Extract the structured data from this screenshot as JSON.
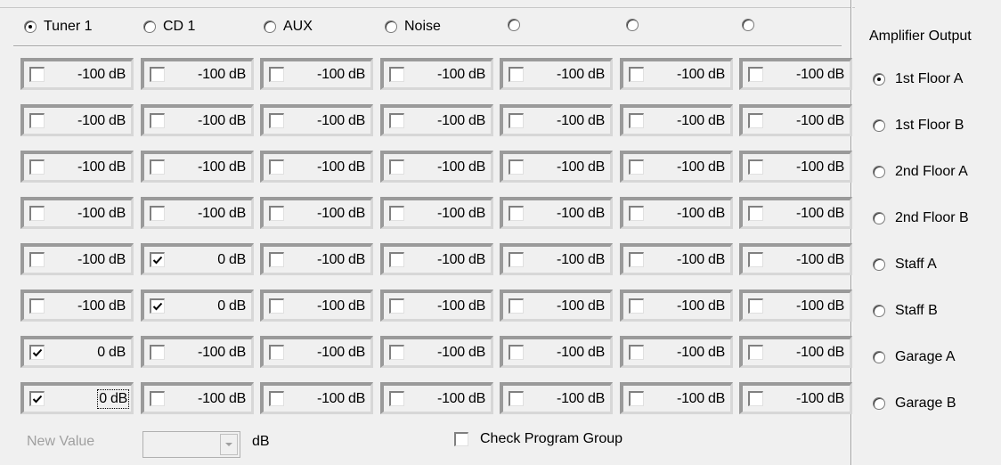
{
  "sources": [
    {
      "label": "Tuner 1",
      "checked": true
    },
    {
      "label": "CD 1",
      "checked": false
    },
    {
      "label": "AUX",
      "checked": false
    },
    {
      "label": "Noise",
      "checked": false
    },
    {
      "label": "",
      "checked": false
    },
    {
      "label": "",
      "checked": false
    },
    {
      "label": "",
      "checked": false
    }
  ],
  "grid": [
    [
      {
        "checked": false,
        "value": "-100 dB"
      },
      {
        "checked": false,
        "value": "-100 dB"
      },
      {
        "checked": false,
        "value": "-100 dB"
      },
      {
        "checked": false,
        "value": "-100 dB"
      },
      {
        "checked": false,
        "value": "-100 dB"
      },
      {
        "checked": false,
        "value": "-100 dB"
      },
      {
        "checked": false,
        "value": "-100 dB"
      }
    ],
    [
      {
        "checked": false,
        "value": "-100 dB"
      },
      {
        "checked": false,
        "value": "-100 dB"
      },
      {
        "checked": false,
        "value": "-100 dB"
      },
      {
        "checked": false,
        "value": "-100 dB"
      },
      {
        "checked": false,
        "value": "-100 dB"
      },
      {
        "checked": false,
        "value": "-100 dB"
      },
      {
        "checked": false,
        "value": "-100 dB"
      }
    ],
    [
      {
        "checked": false,
        "value": "-100 dB"
      },
      {
        "checked": false,
        "value": "-100 dB"
      },
      {
        "checked": false,
        "value": "-100 dB"
      },
      {
        "checked": false,
        "value": "-100 dB"
      },
      {
        "checked": false,
        "value": "-100 dB"
      },
      {
        "checked": false,
        "value": "-100 dB"
      },
      {
        "checked": false,
        "value": "-100 dB"
      }
    ],
    [
      {
        "checked": false,
        "value": "-100 dB"
      },
      {
        "checked": false,
        "value": "-100 dB"
      },
      {
        "checked": false,
        "value": "-100 dB"
      },
      {
        "checked": false,
        "value": "-100 dB"
      },
      {
        "checked": false,
        "value": "-100 dB"
      },
      {
        "checked": false,
        "value": "-100 dB"
      },
      {
        "checked": false,
        "value": "-100 dB"
      }
    ],
    [
      {
        "checked": false,
        "value": "-100 dB"
      },
      {
        "checked": true,
        "value": "0 dB"
      },
      {
        "checked": false,
        "value": "-100 dB"
      },
      {
        "checked": false,
        "value": "-100 dB"
      },
      {
        "checked": false,
        "value": "-100 dB"
      },
      {
        "checked": false,
        "value": "-100 dB"
      },
      {
        "checked": false,
        "value": "-100 dB"
      }
    ],
    [
      {
        "checked": false,
        "value": "-100 dB"
      },
      {
        "checked": true,
        "value": "0 dB"
      },
      {
        "checked": false,
        "value": "-100 dB"
      },
      {
        "checked": false,
        "value": "-100 dB"
      },
      {
        "checked": false,
        "value": "-100 dB"
      },
      {
        "checked": false,
        "value": "-100 dB"
      },
      {
        "checked": false,
        "value": "-100 dB"
      }
    ],
    [
      {
        "checked": true,
        "value": "0 dB"
      },
      {
        "checked": false,
        "value": "-100 dB"
      },
      {
        "checked": false,
        "value": "-100 dB"
      },
      {
        "checked": false,
        "value": "-100 dB"
      },
      {
        "checked": false,
        "value": "-100 dB"
      },
      {
        "checked": false,
        "value": "-100 dB"
      },
      {
        "checked": false,
        "value": "-100 dB"
      }
    ],
    [
      {
        "checked": true,
        "value": "0 dB",
        "focused": true
      },
      {
        "checked": false,
        "value": "-100 dB"
      },
      {
        "checked": false,
        "value": "-100 dB"
      },
      {
        "checked": false,
        "value": "-100 dB"
      },
      {
        "checked": false,
        "value": "-100 dB"
      },
      {
        "checked": false,
        "value": "-100 dB"
      },
      {
        "checked": false,
        "value": "-100 dB"
      }
    ]
  ],
  "amplifier": {
    "title": "Amplifier Output",
    "outputs": [
      {
        "label": "1st Floor A",
        "checked": true
      },
      {
        "label": "1st Floor B",
        "checked": false
      },
      {
        "label": "2nd Floor A",
        "checked": false
      },
      {
        "label": "2nd Floor B",
        "checked": false
      },
      {
        "label": "Staff A",
        "checked": false
      },
      {
        "label": "Staff B",
        "checked": false
      },
      {
        "label": "Garage A",
        "checked": false
      },
      {
        "label": "Garage B",
        "checked": false
      }
    ]
  },
  "footer": {
    "new_value_label": "New Value",
    "new_value": "",
    "unit_label": "dB",
    "check_program_group_label": "Check Program Group",
    "check_program_group_checked": false
  }
}
